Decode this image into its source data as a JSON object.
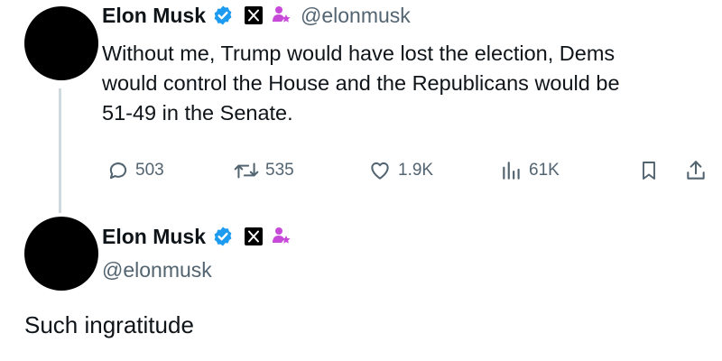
{
  "tweet1": {
    "author_name": "Elon Musk",
    "handle": "@elonmusk",
    "text_lines": [
      "Without me, Trump would have lost the election, Dems",
      "would control the House and the Republicans would be",
      "51-49 in the Senate."
    ],
    "stats": {
      "replies": "503",
      "reposts": "535",
      "likes": "1.9K",
      "views": "61K"
    }
  },
  "tweet2": {
    "author_name": "Elon Musk",
    "handle": "@elonmusk",
    "text": "Such ingratitude"
  },
  "icons": {
    "verified": "verified-badge-icon",
    "affiliate": "x-logo-icon",
    "government": "person-star-icon",
    "reply": "speech-bubble-icon",
    "repost": "repost-arrows-icon",
    "like": "heart-icon",
    "views": "bar-chart-icon",
    "bookmark": "bookmark-icon",
    "share": "share-upload-icon"
  },
  "colors": {
    "verified_blue": "#1d9bf0",
    "government_purple": "#c74bd8",
    "secondary_text": "#536471",
    "thread_line": "#cfd9de"
  }
}
